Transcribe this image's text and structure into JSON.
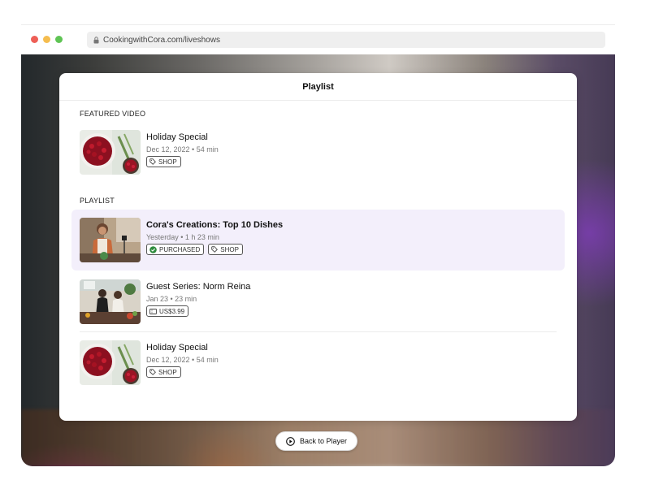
{
  "browser": {
    "url": "CookingwithCora.com/liveshows",
    "lock_icon": "lock-icon"
  },
  "playlist_modal": {
    "title": "Playlist",
    "featured": {
      "section_label": "FEATURED VIDEO",
      "item": {
        "title": "Holiday Special",
        "meta": "Dec 12, 2022 • 54 min",
        "tags": [
          {
            "icon": "tag-icon",
            "label": "SHOP"
          }
        ]
      }
    },
    "playlist": {
      "section_label": "PLAYLIST",
      "items": [
        {
          "title": "Cora's Creations: Top 10 Dishes",
          "meta": "Yesterday • 1 h 23 min",
          "selected": true,
          "tags": [
            {
              "icon": "check-circle-icon",
              "label": "PURCHASED"
            },
            {
              "icon": "tag-icon",
              "label": "SHOP"
            }
          ]
        },
        {
          "title": "Guest Series: Norm Reina",
          "meta": "Jan 23 • 23 min",
          "selected": false,
          "tags": [
            {
              "icon": "ticket-icon",
              "label": "US$3.99"
            }
          ]
        },
        {
          "title": "Holiday Special",
          "meta": "Dec 12, 2022 • 54 min",
          "selected": false,
          "tags": [
            {
              "icon": "tag-icon",
              "label": "SHOP"
            }
          ]
        }
      ]
    }
  },
  "back_button": {
    "icon": "play-circle-icon",
    "label": "Back to Player"
  },
  "colors": {
    "selected_row_bg": "#f3effb",
    "purchased_check": "#2e8b3d",
    "traffic_red": "#ee5f57",
    "traffic_yellow": "#f5bd4f",
    "traffic_green": "#5fc454"
  }
}
